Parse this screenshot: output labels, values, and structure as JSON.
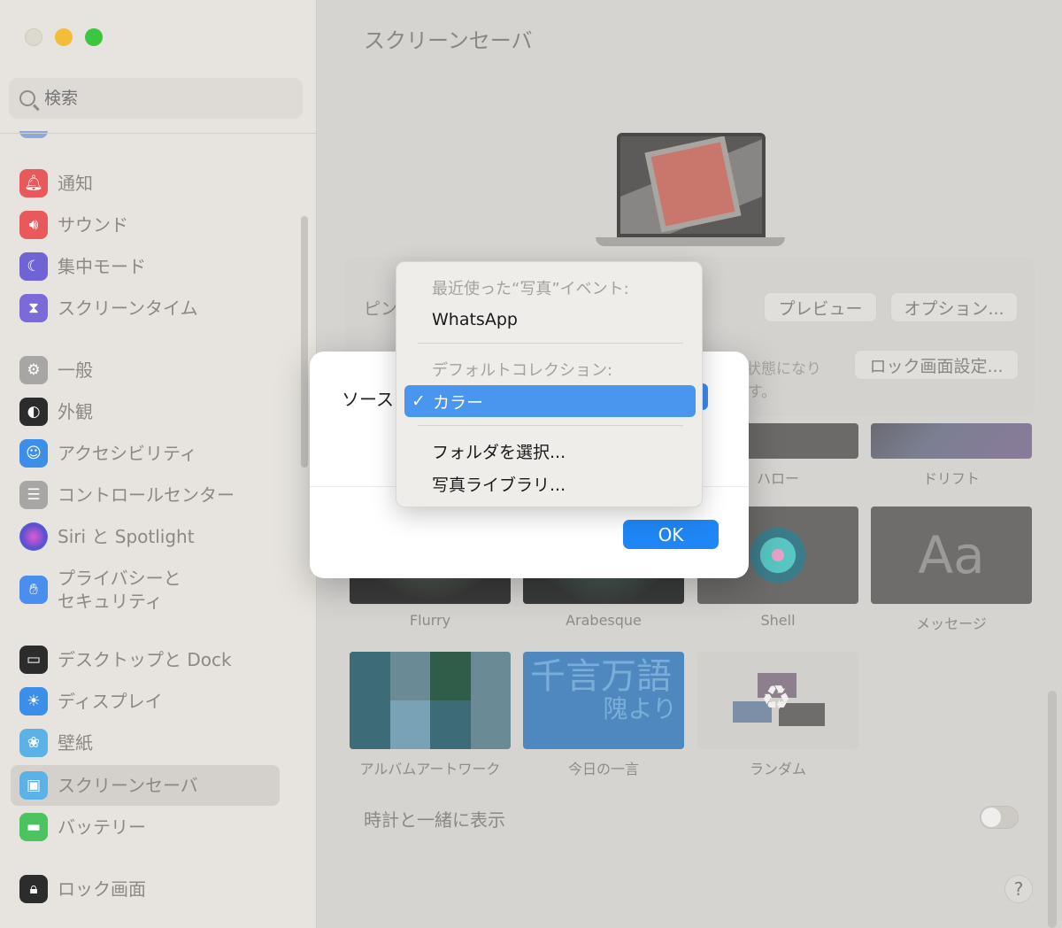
{
  "sidebar": {
    "search_placeholder": "検索",
    "items": [
      {
        "label": "通知",
        "icon": "bell-icon",
        "color": "#e9595c"
      },
      {
        "label": "サウンド",
        "icon": "speaker-icon",
        "color": "#e9595c"
      },
      {
        "label": "集中モード",
        "icon": "moon-icon",
        "color": "#6f63d6"
      },
      {
        "label": "スクリーンタイム",
        "icon": "hourglass-icon",
        "color": "#7b6ad8"
      },
      {
        "label": "一般",
        "icon": "gear-icon",
        "color": "#a7a6a4"
      },
      {
        "label": "外観",
        "icon": "appearance-icon",
        "color": "#2c2c2c"
      },
      {
        "label": "アクセシビリティ",
        "icon": "accessibility-icon",
        "color": "#3d8ee8"
      },
      {
        "label": "コントロールセンター",
        "icon": "control-center-icon",
        "color": "#a7a6a4"
      },
      {
        "label": "Siri と Spotlight",
        "icon": "siri-icon",
        "color": "#5b4fd0"
      },
      {
        "label": "プライバシーと\nセキュリティ",
        "icon": "hand-icon",
        "color": "#4c8df0"
      },
      {
        "label": "デスクトップと Dock",
        "icon": "dock-icon",
        "color": "#2c2c2c"
      },
      {
        "label": "ディスプレイ",
        "icon": "display-icon",
        "color": "#3d8ee8"
      },
      {
        "label": "壁紙",
        "icon": "wallpaper-icon",
        "color": "#5cb2e6"
      },
      {
        "label": "スクリーンセーバ",
        "icon": "screensaver-icon",
        "color": "#5cb2e6"
      },
      {
        "label": "バッテリー",
        "icon": "battery-icon",
        "color": "#4cc260"
      },
      {
        "label": "ロック画面",
        "icon": "lock-icon",
        "color": "#2c2c2c"
      }
    ],
    "selected": "スクリーンセーバ"
  },
  "main": {
    "title": "スクリーンセーバ",
    "preview_label_partial": "ピン",
    "preview_button": "プレビュー",
    "options_button": "オプション...",
    "idle_text_partial": "状態になり",
    "idle_text_partial2": "す。",
    "lock_settings_button": "ロック画面設定...",
    "thumbnails": [
      {
        "label": "ハロー",
        "style": "dark"
      },
      {
        "label": "ドリフト",
        "style": "drift"
      },
      {
        "label": "Flurry",
        "style": "flurry"
      },
      {
        "label": "Arabesque",
        "style": "arabesque"
      },
      {
        "label": "Shell",
        "style": "shell"
      },
      {
        "label": "メッセージ",
        "style": "message",
        "glyph": "Aa"
      },
      {
        "label": "アルバムアートワーク",
        "style": "album"
      },
      {
        "label": "今日の一言",
        "style": "word",
        "line1": "千言万語",
        "line2": "隗より"
      },
      {
        "label": "ランダム",
        "style": "random"
      }
    ],
    "show_with_clock": "時計と一緒に表示",
    "show_with_clock_on": false,
    "help": "?"
  },
  "sheet": {
    "source_label": "ソース",
    "ok_button": "OK"
  },
  "menu": {
    "recent_header": "最近使った“写真”イベント:",
    "recent_item": "WhatsApp",
    "default_header": "デフォルトコレクション:",
    "selected_item": "カラー",
    "check": "✓",
    "choose_folder": "フォルダを選択...",
    "photo_library": "写真ライブラリ..."
  },
  "colors": {
    "accent": "#1f86f5",
    "menu_highlight": "#4a95ee"
  }
}
